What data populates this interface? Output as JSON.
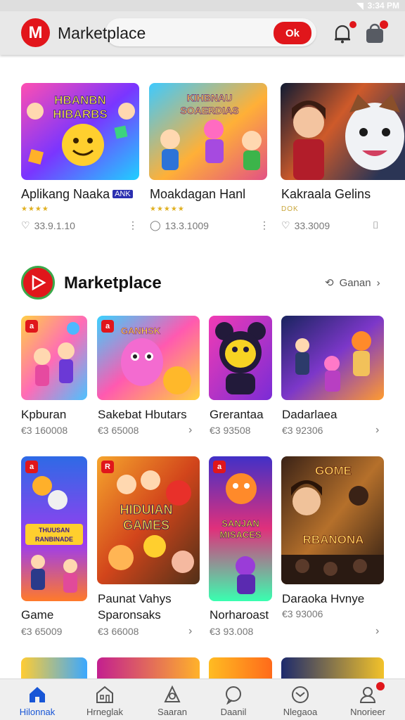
{
  "status": {
    "time": "3:34 PM"
  },
  "header": {
    "logo_letter": "M",
    "title": "Marketplace",
    "search_button_label": "Ok"
  },
  "featured": [
    {
      "name": "Aplikang Naaka",
      "tag": "ANK",
      "stars": "★★★★",
      "count": "33.9.1.10",
      "art_text": "HBANBN HIBARBS",
      "colors": [
        "#ff4fb1",
        "#7a35ff",
        "#1fd0ff"
      ]
    },
    {
      "name": "Moakdagan Hanl",
      "tag": "",
      "stars": "★★★★★",
      "count": "13.3.1009",
      "art_text": "KIHBNAU SOAERDIAS",
      "colors": [
        "#3ecaff",
        "#ffb037",
        "#e24f86"
      ]
    },
    {
      "name": "Kakraala Gelins",
      "tag": "",
      "stars": "DOK",
      "count": "33.3009",
      "art_text": "",
      "colors": [
        "#101b33",
        "#ce5a2a",
        "#f0f2f5"
      ]
    }
  ],
  "section": {
    "title": "Marketplace",
    "see_all": "Ganan"
  },
  "row1": [
    {
      "badge": "a",
      "name": "Kpburan",
      "price": "€3 160008",
      "colors": [
        "#ffcf47",
        "#ff6bb6",
        "#4bc2ff"
      ]
    },
    {
      "badge": "a",
      "name": "Sakebat Hbutars",
      "price": "€3 65008",
      "colors": [
        "#39d2ff",
        "#ff59b0",
        "#ffd23d"
      ]
    },
    {
      "badge": "",
      "name": "Grerantaa",
      "price": "€3 93508",
      "colors": [
        "#f13bb4",
        "#7a2cd6",
        "#f7d323"
      ]
    },
    {
      "badge": "",
      "name": "Dadarlaea",
      "price": "€3 92306",
      "colors": [
        "#18245e",
        "#7c37c9",
        "#ff9b2f"
      ]
    }
  ],
  "row2": [
    {
      "badge": "a",
      "name": "Game",
      "price": "€3 65009",
      "colors": [
        "#2e6ae6",
        "#ff7a2a",
        "#9b3cf0"
      ],
      "art_text": "THUUSAN RANBINADE"
    },
    {
      "badge": "R",
      "name": "Paunat Vahys",
      "name2": "Sparonsaks",
      "price": "€3 66008",
      "colors": [
        "#f6a52d",
        "#d2451b",
        "#513018"
      ],
      "art_text": "HIDUIAN GAMES"
    },
    {
      "badge": "a",
      "name": "Norharoast",
      "price": "€3 93.008",
      "colors": [
        "#4130c7",
        "#e0307b",
        "#39ffb0"
      ],
      "art_text": "SANJAN MISACES"
    },
    {
      "badge": "",
      "name": "Daraoka Hvnye",
      "price": "€3 93006",
      "colors": [
        "#3a2216",
        "#b5702b",
        "#ffd15e"
      ],
      "art_text": "GOME RBANONA"
    }
  ],
  "row3_colors": [
    [
      "#ffcc33",
      "#3ba8ff"
    ],
    [
      "#c31f8f",
      "#ffb22a"
    ],
    [
      "#ffbc22",
      "#ff6a1a"
    ],
    [
      "#1d2a6c",
      "#f2c22a"
    ]
  ],
  "nav": [
    {
      "label": "Hilonnak",
      "icon": "home-icon"
    },
    {
      "label": "Hrneglak",
      "icon": "store-icon"
    },
    {
      "label": "Saaran",
      "icon": "discover-icon"
    },
    {
      "label": "Daanil",
      "icon": "chat-icon"
    },
    {
      "label": "Nlegaoa",
      "icon": "messages-icon"
    },
    {
      "label": "Nnorieer",
      "icon": "profile-icon"
    }
  ],
  "accent": "#e0161b",
  "active_nav_color": "#1856d6"
}
